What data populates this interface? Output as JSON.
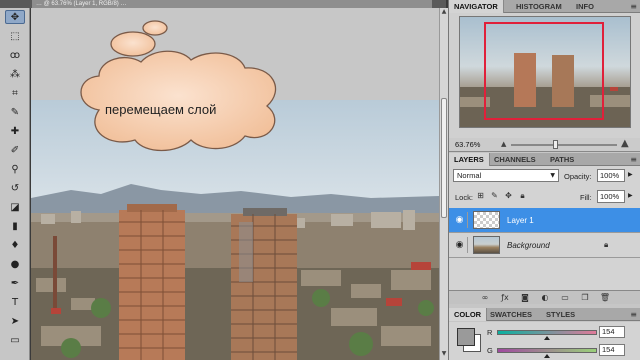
{
  "document": {
    "tab_title": "… @ 63.76% (Layer 1, RGB/8) …"
  },
  "annotation": {
    "text": "перемещаем слой"
  },
  "toolbar": {
    "tools": [
      {
        "name": "move-tool",
        "glyph": "✥",
        "active": true
      },
      {
        "name": "marquee-tool",
        "glyph": "⬚"
      },
      {
        "name": "lasso-tool",
        "glyph": "ꝏ"
      },
      {
        "name": "quick-selection-tool",
        "glyph": "⁂"
      },
      {
        "name": "crop-tool",
        "glyph": "⌗"
      },
      {
        "name": "eyedropper-tool",
        "glyph": "✎"
      },
      {
        "name": "healing-brush-tool",
        "glyph": "✚"
      },
      {
        "name": "brush-tool",
        "glyph": "🖌"
      },
      {
        "name": "clone-stamp-tool",
        "glyph": "⚲"
      },
      {
        "name": "history-brush-tool",
        "glyph": "↺"
      },
      {
        "name": "eraser-tool",
        "glyph": "◪"
      },
      {
        "name": "gradient-tool",
        "glyph": "▮"
      },
      {
        "name": "blur-tool",
        "glyph": "💧"
      },
      {
        "name": "dodge-tool",
        "glyph": "●"
      },
      {
        "name": "pen-tool",
        "glyph": "✒"
      },
      {
        "name": "type-tool",
        "glyph": "T"
      },
      {
        "name": "path-selection-tool",
        "glyph": "➤"
      },
      {
        "name": "rectangle-tool",
        "glyph": "▭"
      }
    ]
  },
  "navigator_panel": {
    "tabs": [
      "NAVIGATOR",
      "HISTOGRAM",
      "INFO"
    ],
    "zoom": "63.76%"
  },
  "layers_panel": {
    "tabs": [
      "LAYERS",
      "CHANNELS",
      "PATHS"
    ],
    "blend_mode": "Normal",
    "opacity_label": "Opacity:",
    "opacity": "100%",
    "lock_label": "Lock:",
    "fill_label": "Fill:",
    "fill": "100%",
    "layers": [
      {
        "name": "Layer 1",
        "selected": true
      },
      {
        "name": "Background",
        "selected": false,
        "locked": true
      }
    ]
  },
  "color_panel": {
    "tabs": [
      "COLOR",
      "SWATCHES",
      "STYLES"
    ],
    "channels": [
      {
        "label": "R",
        "value": "154"
      },
      {
        "label": "G",
        "value": "154"
      }
    ],
    "foreground": "#9a9a9a",
    "background": "#ffffff"
  },
  "colors": {
    "selection_blue": "#3d8fe6",
    "nav_frame": "#e0203a"
  }
}
